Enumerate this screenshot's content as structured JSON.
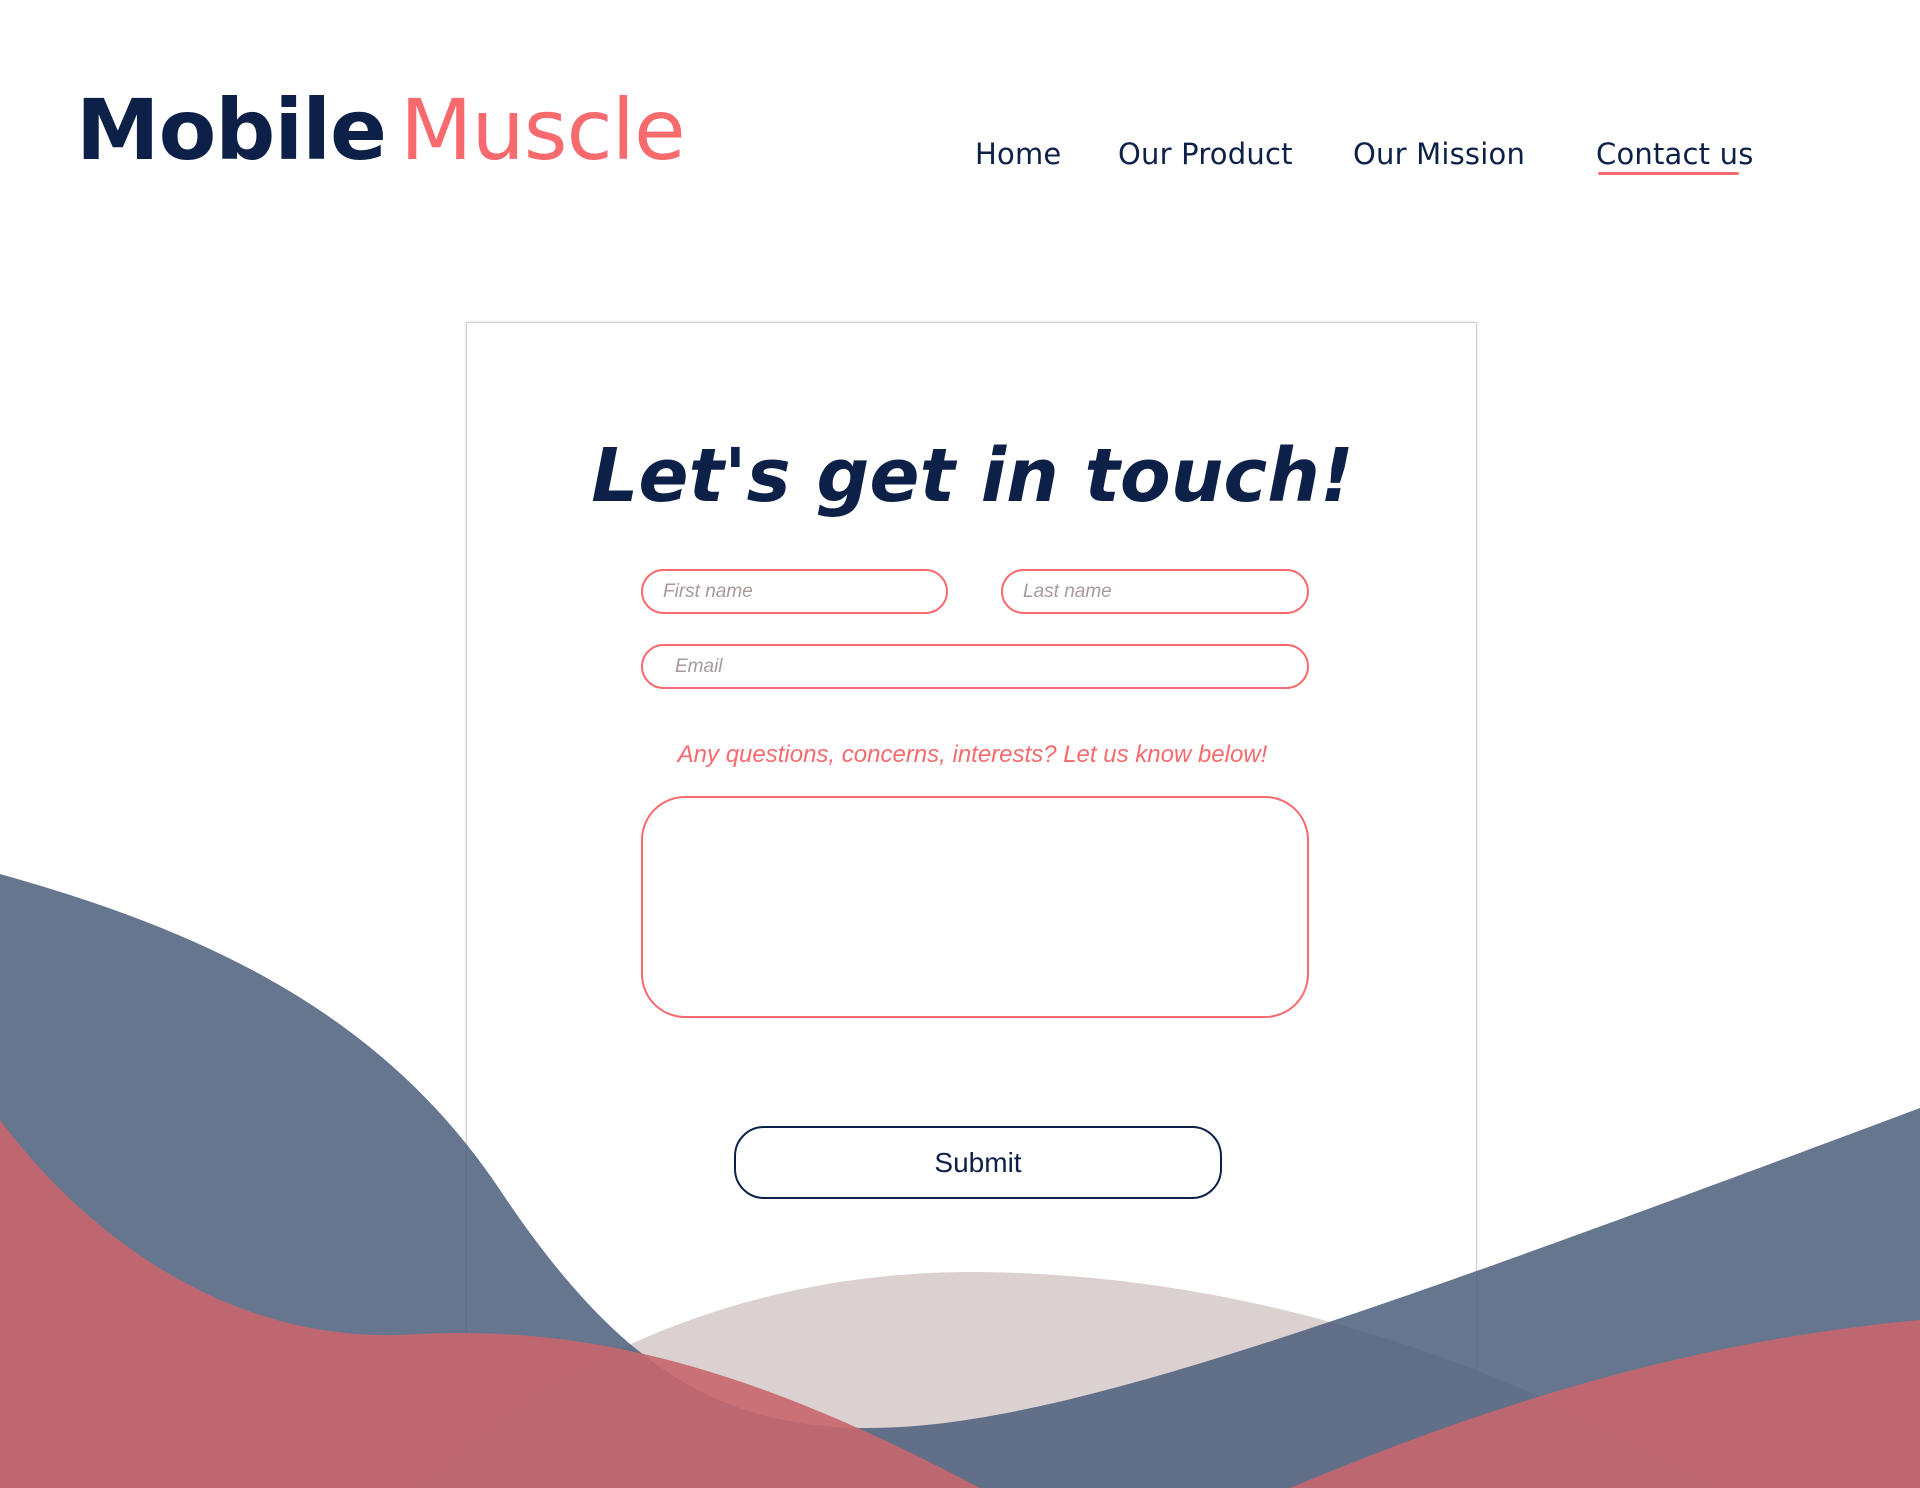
{
  "brand": {
    "name_primary": "Mobile",
    "name_accent": "Muscle"
  },
  "nav": {
    "items": [
      {
        "label": "Home"
      },
      {
        "label": "Our Product"
      },
      {
        "label": "Our Mission"
      },
      {
        "label": "Contact us",
        "active": true
      }
    ]
  },
  "form": {
    "title": "Let's get in touch!",
    "first_name_placeholder": "First name",
    "last_name_placeholder": "Last name",
    "email_placeholder": "Email",
    "prompt": "Any questions, concerns, interests? Let us know below!",
    "message_value": "",
    "submit_label": "Submit"
  },
  "colors": {
    "navy": "#0d2148",
    "coral": "#f76a6d",
    "wave_navy": "#4b5e7b",
    "wave_red": "#c8666e",
    "wave_beige": "#d9cfcd",
    "placeholder": "#a89a9a"
  }
}
